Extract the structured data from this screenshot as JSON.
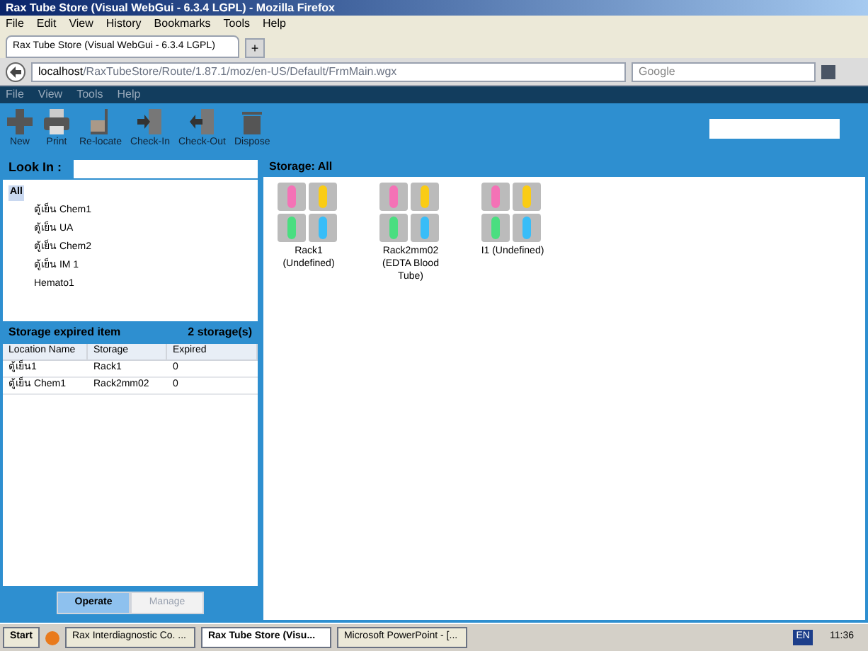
{
  "window": {
    "title": "Rax Tube Store (Visual WebGui - 6.3.4 LGPL) - Mozilla Firefox"
  },
  "browser_menu": [
    "File",
    "Edit",
    "View",
    "History",
    "Bookmarks",
    "Tools",
    "Help"
  ],
  "browser_tab": {
    "title": "Rax Tube Store (Visual WebGui - 6.3.4 LGPL)",
    "new_tab": "+"
  },
  "address": {
    "host": "localhost",
    "path": "/RaxTubeStore/Route/1.87.1/moz/en-US/Default/FrmMain.wgx"
  },
  "search": {
    "placeholder": "Google"
  },
  "app_menu": [
    "File",
    "View",
    "Tools",
    "Help"
  ],
  "toolbar": [
    {
      "label": "New",
      "kind": "new"
    },
    {
      "label": "Print",
      "kind": "print"
    },
    {
      "label": "Re-locate",
      "kind": "relocate"
    },
    {
      "label": "Check-In",
      "kind": "checkin"
    },
    {
      "label": "Check-Out",
      "kind": "checkout"
    },
    {
      "label": "Dispose",
      "kind": "dispose"
    }
  ],
  "look_in": {
    "label": "Look In :"
  },
  "tree": {
    "label": "All",
    "expanded": true,
    "children": [
      {
        "label": "ตู้เย็น Chem1"
      },
      {
        "label": "ตู้เย็น UA"
      },
      {
        "label": "ตู้เย็น Chem2"
      },
      {
        "label": "ตู้เย็น IM 1"
      },
      {
        "label": "Hemato1"
      }
    ]
  },
  "expired": {
    "title": "Storage expired item",
    "count": "2 storage(s)",
    "columns": [
      "Location Name",
      "Storage",
      "Expired"
    ],
    "rows": [
      [
        "ตู้เย็น1",
        "Rack1",
        "0"
      ],
      [
        "ตู้เย็น Chem1",
        "Rack2mm02",
        "0"
      ]
    ]
  },
  "mode_tabs": [
    {
      "label": "Operate",
      "selected": true
    },
    {
      "label": "Manage",
      "selected": false
    }
  ],
  "storage": {
    "title": "Storage: All",
    "racks": [
      "Rack1 (Undefined)",
      "Rack2mm02 (EDTA Blood Tube)",
      "I1 (Undefined)"
    ]
  },
  "taskbar": {
    "start": "Start",
    "tasks": [
      {
        "label": "Rax Interdiagnostic Co. ...",
        "selected": false
      },
      {
        "label": "Rax Tube Store (Visu...",
        "selected": true
      },
      {
        "label": "Microsoft PowerPoint - [...",
        "selected": false
      }
    ],
    "lang": "EN",
    "time": "11:36"
  }
}
